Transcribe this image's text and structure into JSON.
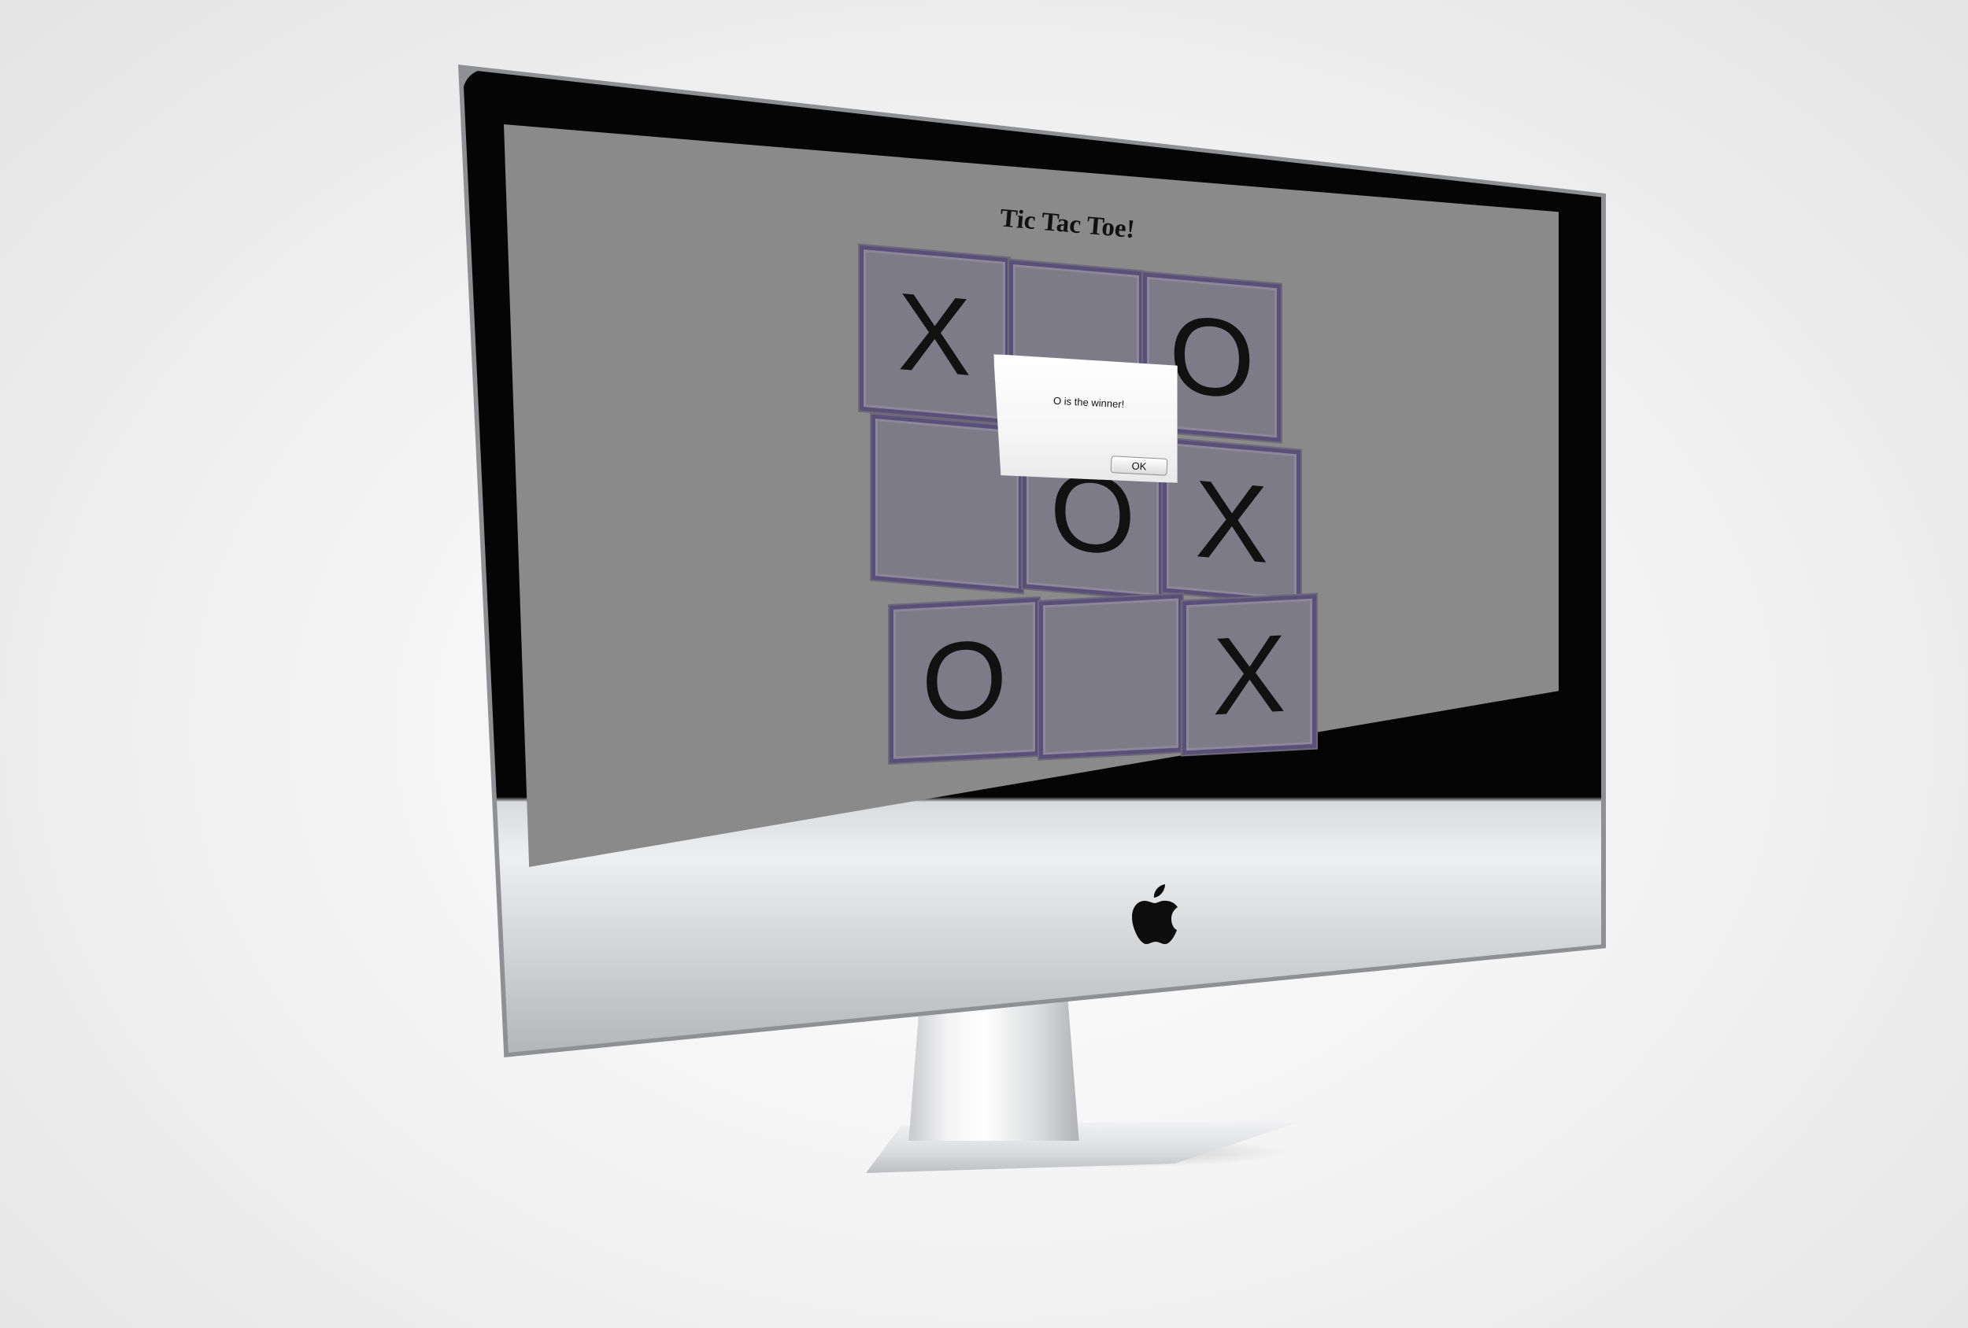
{
  "app": {
    "title": "Tic Tac Toe!"
  },
  "board": {
    "cells": [
      [
        "X",
        "",
        "O"
      ],
      [
        "",
        "O",
        "X"
      ],
      [
        "O",
        "",
        "X"
      ]
    ]
  },
  "dialog": {
    "message": "O is the winner!",
    "ok_label": "OK"
  },
  "colors": {
    "page_background": "#8a8a8a",
    "cell_fill": "#7c7b87",
    "cell_border": "#5a4f79",
    "mark": "#111111"
  },
  "icons": {
    "monitor_logo": "apple-logo-icon"
  }
}
